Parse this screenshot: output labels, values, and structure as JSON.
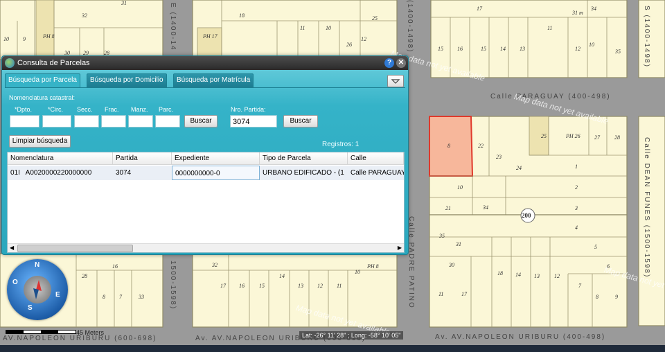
{
  "map": {
    "streets": {
      "paraguay": "Calle PARAGUAY (400-498)",
      "napoleon_left": "AV.NAPOLEON URIBURU (600-698)",
      "napoleon_mid": "Av. AV.NAPOLEON URIBURU (600-698)",
      "napoleon_right": "Av. AV.NAPOLEON URIBURU (400-498)",
      "dean_funes_top": "S (1400-1498)",
      "dean_funes_right": "Calle DEAN FUNES (1500-1598)",
      "padre_patino": "Calle PADRE PATINO",
      "col_1400_a": "E (1400-14",
      "col_1400_b": "(1400-1498)",
      "col_1500": "1500-1598)"
    },
    "block_number": "200",
    "parcel_numbers": [
      "31",
      "32",
      "18",
      "25",
      "10",
      "9",
      "PH 8",
      "PH 17",
      "11",
      "10",
      "26",
      "12",
      "30",
      "29",
      "28",
      "17",
      "34",
      "31 m",
      "11",
      "15",
      "16",
      "15",
      "14",
      "13",
      "12",
      "10",
      "35",
      "8",
      "22",
      "23",
      "24",
      "25",
      "PH 26",
      "27",
      "28",
      "1",
      "2",
      "3",
      "4",
      "5",
      "6",
      "7",
      "8",
      "9",
      "10",
      "21",
      "34",
      "35",
      "31",
      "30",
      "18",
      "14",
      "13",
      "12",
      "11",
      "17",
      "16",
      "28",
      "8",
      "7",
      "33",
      "32",
      "17",
      "16",
      "15",
      "14",
      "13",
      "12",
      "11",
      "10",
      "PH 8"
    ],
    "watermark": "Map data not yet available",
    "scale_label": "45 Meters",
    "coordinates": "Lat: -26° 11' 28\" ; Long: -58° 10' 05\""
  },
  "compass": {
    "n": "N",
    "s": "S",
    "e": "E",
    "o": "O"
  },
  "dialog": {
    "title": "Consulta de Parcelas",
    "tabs": [
      "Búsqueda por Parcela",
      "Búsqueda por Domicilio",
      "Búsqueda por Matrícula"
    ],
    "nomenclatura_label": "Nomenclatura catastral:",
    "fields": [
      "*Dpto.",
      "*Circ.",
      "Secc.",
      "Frac.",
      "Manz.",
      "Parc."
    ],
    "buscar_label": "Buscar",
    "nro_partida_label": "Nro. Partida:",
    "nro_partida_value": "3074",
    "buscar2_label": "Buscar",
    "limpiar_label": "Limpiar búsqueda",
    "registros": "Registros: 1",
    "table": {
      "headers": [
        "Nomenclatura",
        "Partida",
        "Expediente",
        "Tipo de Parcela",
        "Calle"
      ],
      "rows": [
        [
          "01I   A0020000220000000",
          "3074",
          "0000000000-0",
          "URBANO EDIFICADO - (1",
          "Calle PARAGUAY"
        ]
      ]
    }
  },
  "colors": {
    "highlight_parcel": "#f7b79b",
    "dialog_teal": "#35b3c8"
  }
}
